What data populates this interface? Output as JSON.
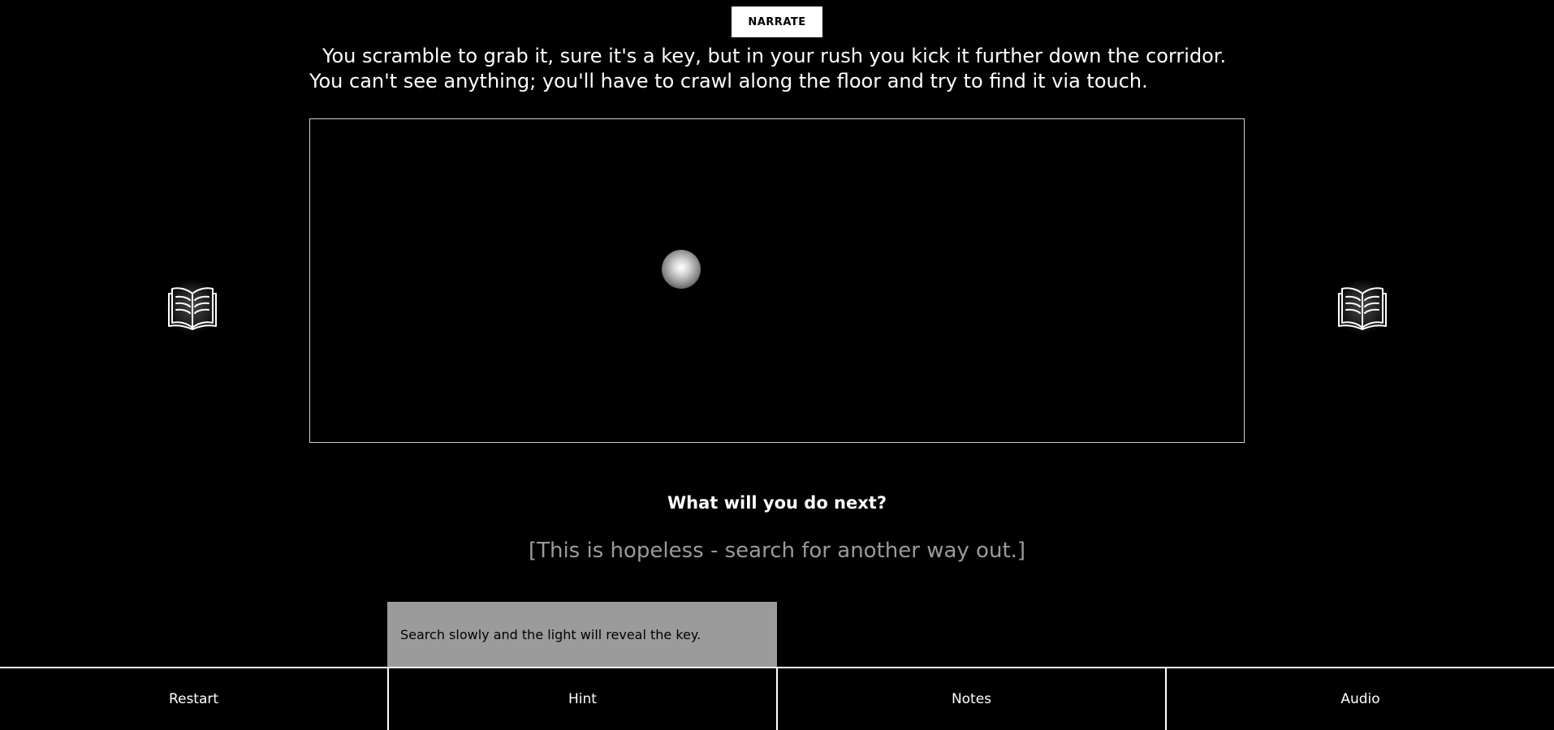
{
  "toolbar": {
    "narrate_label": "NARRATE"
  },
  "story": {
    "line1": "You scramble to grab it, sure it's a key, but in your rush you kick it further down the corridor.",
    "line2": "You can't see anything; you'll have to crawl along the floor and try to find it via touch."
  },
  "search_area": {
    "light": "light-orb"
  },
  "side_buttons": {
    "left_icon": "open-book-icon",
    "right_icon": "open-book-icon"
  },
  "prompt": {
    "question": "What will you do next?",
    "choice": "[This is hopeless - search for another way out.]"
  },
  "hint": {
    "text": "Search slowly and the light will reveal the key."
  },
  "bottom_bar": {
    "restart": "Restart",
    "hint": "Hint",
    "notes": "Notes",
    "audio": "Audio"
  },
  "colors": {
    "background": "#000000",
    "text": "#ffffff",
    "choice_text": "#9a9a9a",
    "hint_bg": "#9b9b9b"
  }
}
